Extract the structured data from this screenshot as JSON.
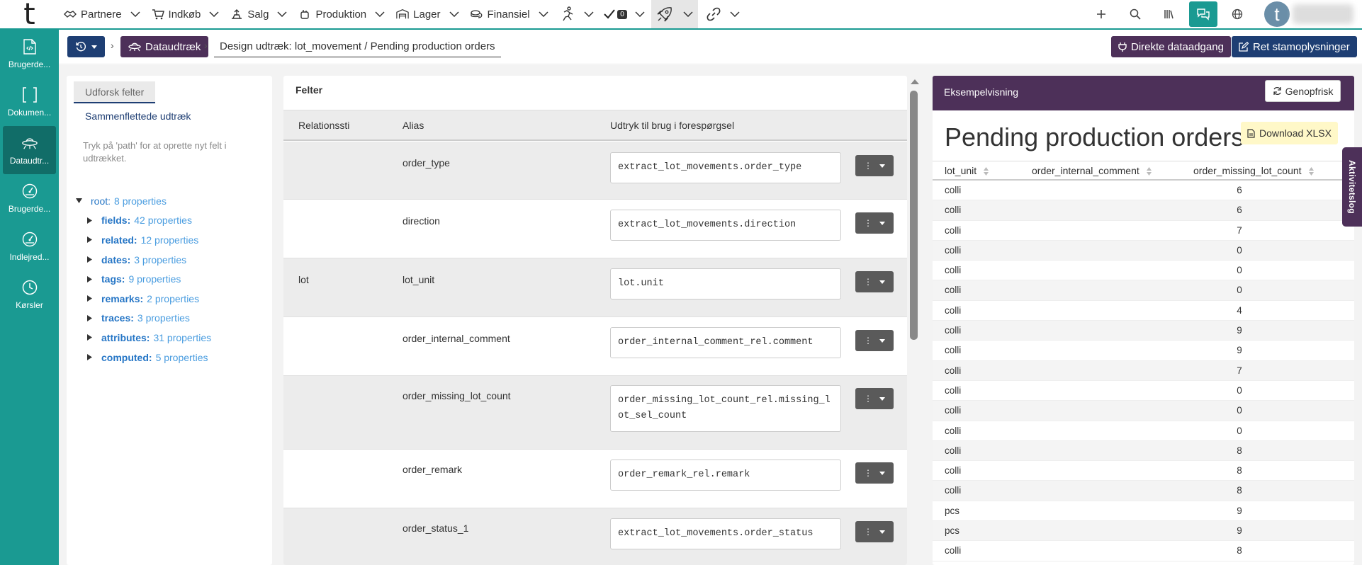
{
  "topnav": {
    "logo": "t",
    "items": [
      {
        "label": "Partnere",
        "icon": "handshake-icon"
      },
      {
        "label": "Indkøb",
        "icon": "cart-icon"
      },
      {
        "label": "Salg",
        "icon": "sales-icon"
      },
      {
        "label": "Produktion",
        "icon": "production-icon"
      },
      {
        "label": "Lager",
        "icon": "warehouse-icon"
      },
      {
        "label": "Finansiel",
        "icon": "coins-icon"
      }
    ],
    "tasks_badge": "0"
  },
  "sidebar": {
    "items": [
      {
        "label": "Brugerde...",
        "icon": "code-file-icon"
      },
      {
        "label": "Dokumen...",
        "icon": "brackets-icon"
      },
      {
        "label": "Dataudtr...",
        "icon": "ufo-icon",
        "active": true
      },
      {
        "label": "Brugerde...",
        "icon": "gauge-icon"
      },
      {
        "label": "Indlejred...",
        "icon": "gauge-icon"
      },
      {
        "label": "Kørsler",
        "icon": "clock-icon"
      }
    ]
  },
  "breadcrumb": {
    "extract_label": "Dataudtræk",
    "title": "Design udtræk: lot_movement / Pending production orders",
    "direct_access_label": "Direkte dataadgang",
    "edit_master_label": "Ret stamoplysninger"
  },
  "left": {
    "tab_explore": "Udforsk felter",
    "tab_merged": "Sammenflettede udtræk",
    "hint": "Tryk på 'path' for at oprette nyt felt i udtrækket.",
    "tree": [
      {
        "key": "root:",
        "count": "8 properties"
      },
      {
        "key": "fields:",
        "count": "42 properties"
      },
      {
        "key": "related:",
        "count": "12 properties"
      },
      {
        "key": "dates:",
        "count": "3 properties"
      },
      {
        "key": "tags:",
        "count": "9 properties"
      },
      {
        "key": "remarks:",
        "count": "2 properties"
      },
      {
        "key": "traces:",
        "count": "3 properties"
      },
      {
        "key": "attributes:",
        "count": "31 properties"
      },
      {
        "key": "computed:",
        "count": "5 properties"
      }
    ]
  },
  "fields": {
    "title": "Felter",
    "headers": {
      "relation": "Relationssti",
      "alias": "Alias",
      "expression": "Udtryk til brug i forespørgsel"
    },
    "rows": [
      {
        "relation": "",
        "alias": "order_type",
        "expression": "extract_lot_movements.order_type"
      },
      {
        "relation": "",
        "alias": "direction",
        "expression": "extract_lot_movements.direction"
      },
      {
        "relation": "lot",
        "alias": "lot_unit",
        "expression": "lot.unit"
      },
      {
        "relation": "",
        "alias": "order_internal_comment",
        "expression": "order_internal_comment_rel.comment"
      },
      {
        "relation": "",
        "alias": "order_missing_lot_count",
        "expression": "order_missing_lot_count_rel.missing_lot_sel_count"
      },
      {
        "relation": "",
        "alias": "order_remark",
        "expression": "order_remark_rel.remark"
      },
      {
        "relation": "",
        "alias": "order_status_1",
        "expression": "extract_lot_movements.order_status"
      }
    ]
  },
  "preview": {
    "header": "Eksempelvisning",
    "refresh_label": "Genopfrisk",
    "title": "Pending production orders",
    "download_label": "Download XLSX",
    "columns": [
      "lot_unit",
      "order_internal_comment",
      "order_missing_lot_count"
    ],
    "rows": [
      [
        "colli",
        "",
        "6"
      ],
      [
        "colli",
        "",
        "6"
      ],
      [
        "colli",
        "",
        "7"
      ],
      [
        "colli",
        "",
        "0"
      ],
      [
        "colli",
        "",
        "0"
      ],
      [
        "colli",
        "",
        "0"
      ],
      [
        "colli",
        "",
        "4"
      ],
      [
        "colli",
        "",
        "9"
      ],
      [
        "colli",
        "",
        "9"
      ],
      [
        "colli",
        "",
        "7"
      ],
      [
        "colli",
        "",
        "0"
      ],
      [
        "colli",
        "",
        "0"
      ],
      [
        "colli",
        "",
        "0"
      ],
      [
        "colli",
        "",
        "8"
      ],
      [
        "colli",
        "",
        "8"
      ],
      [
        "colli",
        "",
        "8"
      ],
      [
        "pcs",
        "",
        "9"
      ],
      [
        "pcs",
        "",
        "9"
      ],
      [
        "colli",
        "",
        "8"
      ]
    ]
  },
  "activity_tab": "Aktivitetslog",
  "colors": {
    "teal": "#1a9a92",
    "purple": "#4d3059",
    "navy": "#1e3e73"
  }
}
